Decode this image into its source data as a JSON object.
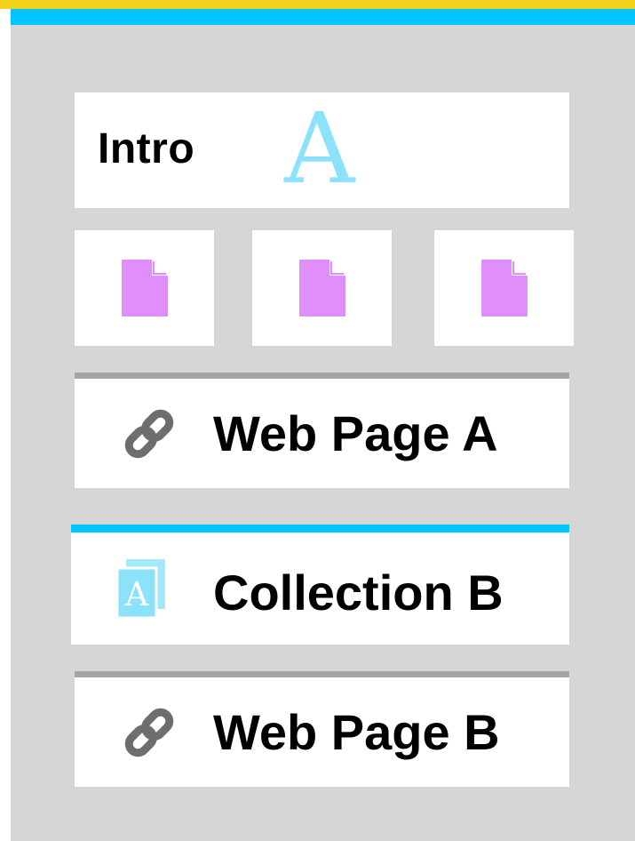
{
  "panel": {
    "accent_color": "#00c4ff",
    "background_color": "#d6d6d6"
  },
  "intro": {
    "label": "Intro",
    "letter": "A",
    "letter_color": "#8de2fb"
  },
  "documents": [
    {
      "icon": "document-icon",
      "color": "#e08ffa"
    },
    {
      "icon": "document-icon",
      "color": "#e08ffa"
    },
    {
      "icon": "document-icon",
      "color": "#e08ffa"
    }
  ],
  "items": [
    {
      "label": "Web Page A",
      "icon": "link-icon"
    },
    {
      "label": "Collection B",
      "icon": "collection-icon",
      "icon_letter": "A"
    },
    {
      "label": "Web Page B",
      "icon": "link-icon"
    }
  ]
}
